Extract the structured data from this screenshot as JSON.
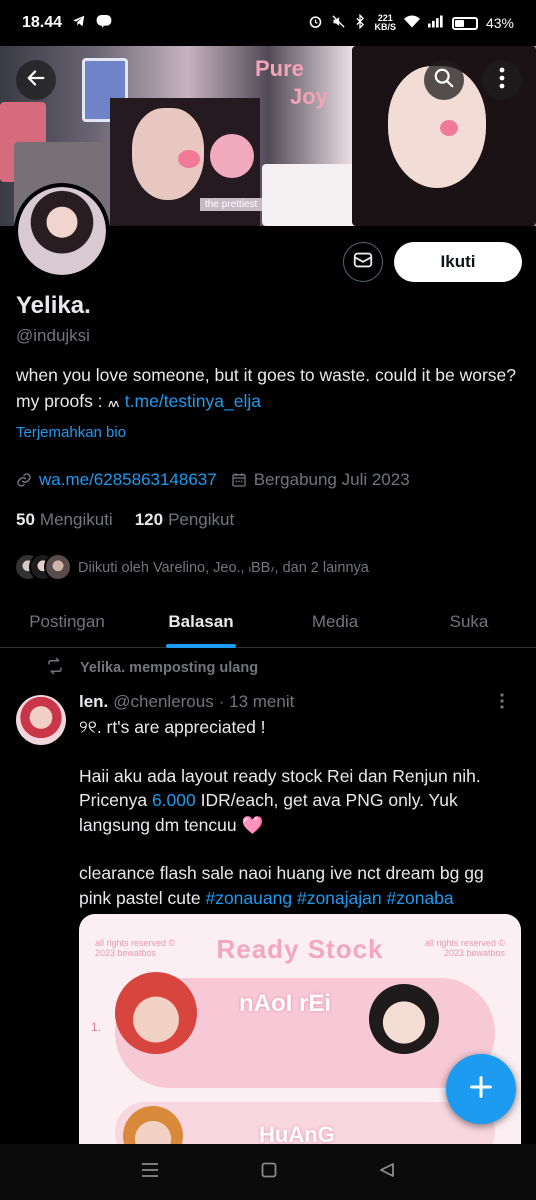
{
  "status_bar": {
    "time": "18.44",
    "speed_value": "221",
    "speed_unit": "KB/S",
    "battery": "43%",
    "battery_level": 0.43
  },
  "banner": {
    "text_line1": "Pure",
    "text_line2": "Joy",
    "caption": "the prettiest"
  },
  "header": {
    "back_icon": "arrow-left-icon",
    "search_icon": "search-icon",
    "more_icon": "more-vertical-icon"
  },
  "profile": {
    "follow_label": "Ikuti",
    "name": "Yelika.",
    "handle": "@indujksi",
    "bio_text": "when you love someone, but it goes to waste. could it be worse? my proofs : ៳ ",
    "bio_link": "t.me/testinya_elja",
    "translate_label": "Terjemahkan bio",
    "website": "wa.me/6285863148637",
    "joined": "Bergabung Juli 2023",
    "following_count": "50",
    "following_label": "Mengikuti",
    "followers_count": "120",
    "followers_label": "Pengikut",
    "followed_by": "Diikuti oleh Varelino, Jeo., ៲BB៸, dan 2 lainnya"
  },
  "tabs": [
    {
      "label": "Postingan"
    },
    {
      "label": "Balasan"
    },
    {
      "label": "Media"
    },
    {
      "label": "Suka"
    }
  ],
  "post": {
    "repost_text": "Yelika. memposting ulang",
    "author": "len.",
    "author_handle": "@chenlerous",
    "time": "· 13 menit",
    "line1": "୨୧.   rt's are appreciated !",
    "para2_before": "Haii aku ada layout ready stock Rei dan Renjun nih. Pricenya ",
    "para2_price": "6.000",
    "para2_after": " IDR/each, get ava PNG only. Yuk langsung dm tencuu ",
    "heart": "🩷",
    "para3_text": "clearance flash sale naoi huang ive nct dream bg gg pink pastel cute ",
    "hashtags": [
      "#zonauang",
      "#zonajajan",
      "#zonaba"
    ],
    "image": {
      "title": "Ready Stock",
      "left_note": "all rights reserved © 2023 bewatbos",
      "right_note": "all rights reserved © 2023 bewatbos",
      "name1": "nAoI rEi",
      "name2": "HuAnG",
      "number": "1."
    }
  },
  "colors": {
    "accent": "#1d9bf0",
    "background": "#000000",
    "secondary_text": "#71767b"
  }
}
